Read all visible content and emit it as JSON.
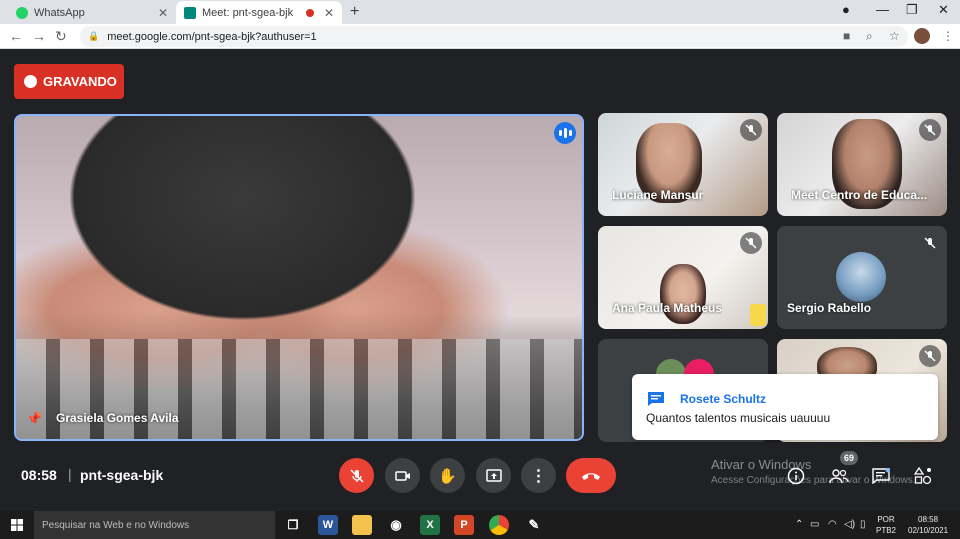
{
  "browser": {
    "tabs": [
      {
        "title": "WhatsApp",
        "favicon_color": "#25d366",
        "active": false
      },
      {
        "title": "Meet: pnt-sgea-bjk",
        "favicon_color": "#00897b",
        "active": true,
        "recording": true
      }
    ],
    "new_tab_glyph": "+",
    "url": "meet.google.com/pnt-sgea-bjk?authuser=1"
  },
  "meet": {
    "recording_label": "GRAVANDO",
    "main_speaker": "Grasiela Gomes Avila",
    "participants": [
      {
        "name": "Luciane Mansur",
        "muted": true
      },
      {
        "name": "Meet Centro de Educa...",
        "muted": true
      },
      {
        "name": "Ana Paula Matheus",
        "muted": true
      },
      {
        "name": "Sergio Rabello",
        "muted": true
      }
    ],
    "chat_toast": {
      "sender": "Rosete Schultz",
      "message": "Quantos talentos musicais uauuuu"
    },
    "time": "08:58",
    "separator": "|",
    "meeting_code": "pnt-sgea-bjk",
    "participant_count": "69",
    "accent_color": "#1a73e8",
    "danger_color": "#ea4335"
  },
  "windows": {
    "activation_title": "Ativar o Windows",
    "activation_sub": "Acesse Configurações para ativar o Windows.",
    "search_placeholder": "Pesquisar na Web e no Windows",
    "lang_line1": "POR",
    "lang_line2": "PTB2",
    "clock_time": "08:58",
    "clock_date": "02/10/2021"
  }
}
